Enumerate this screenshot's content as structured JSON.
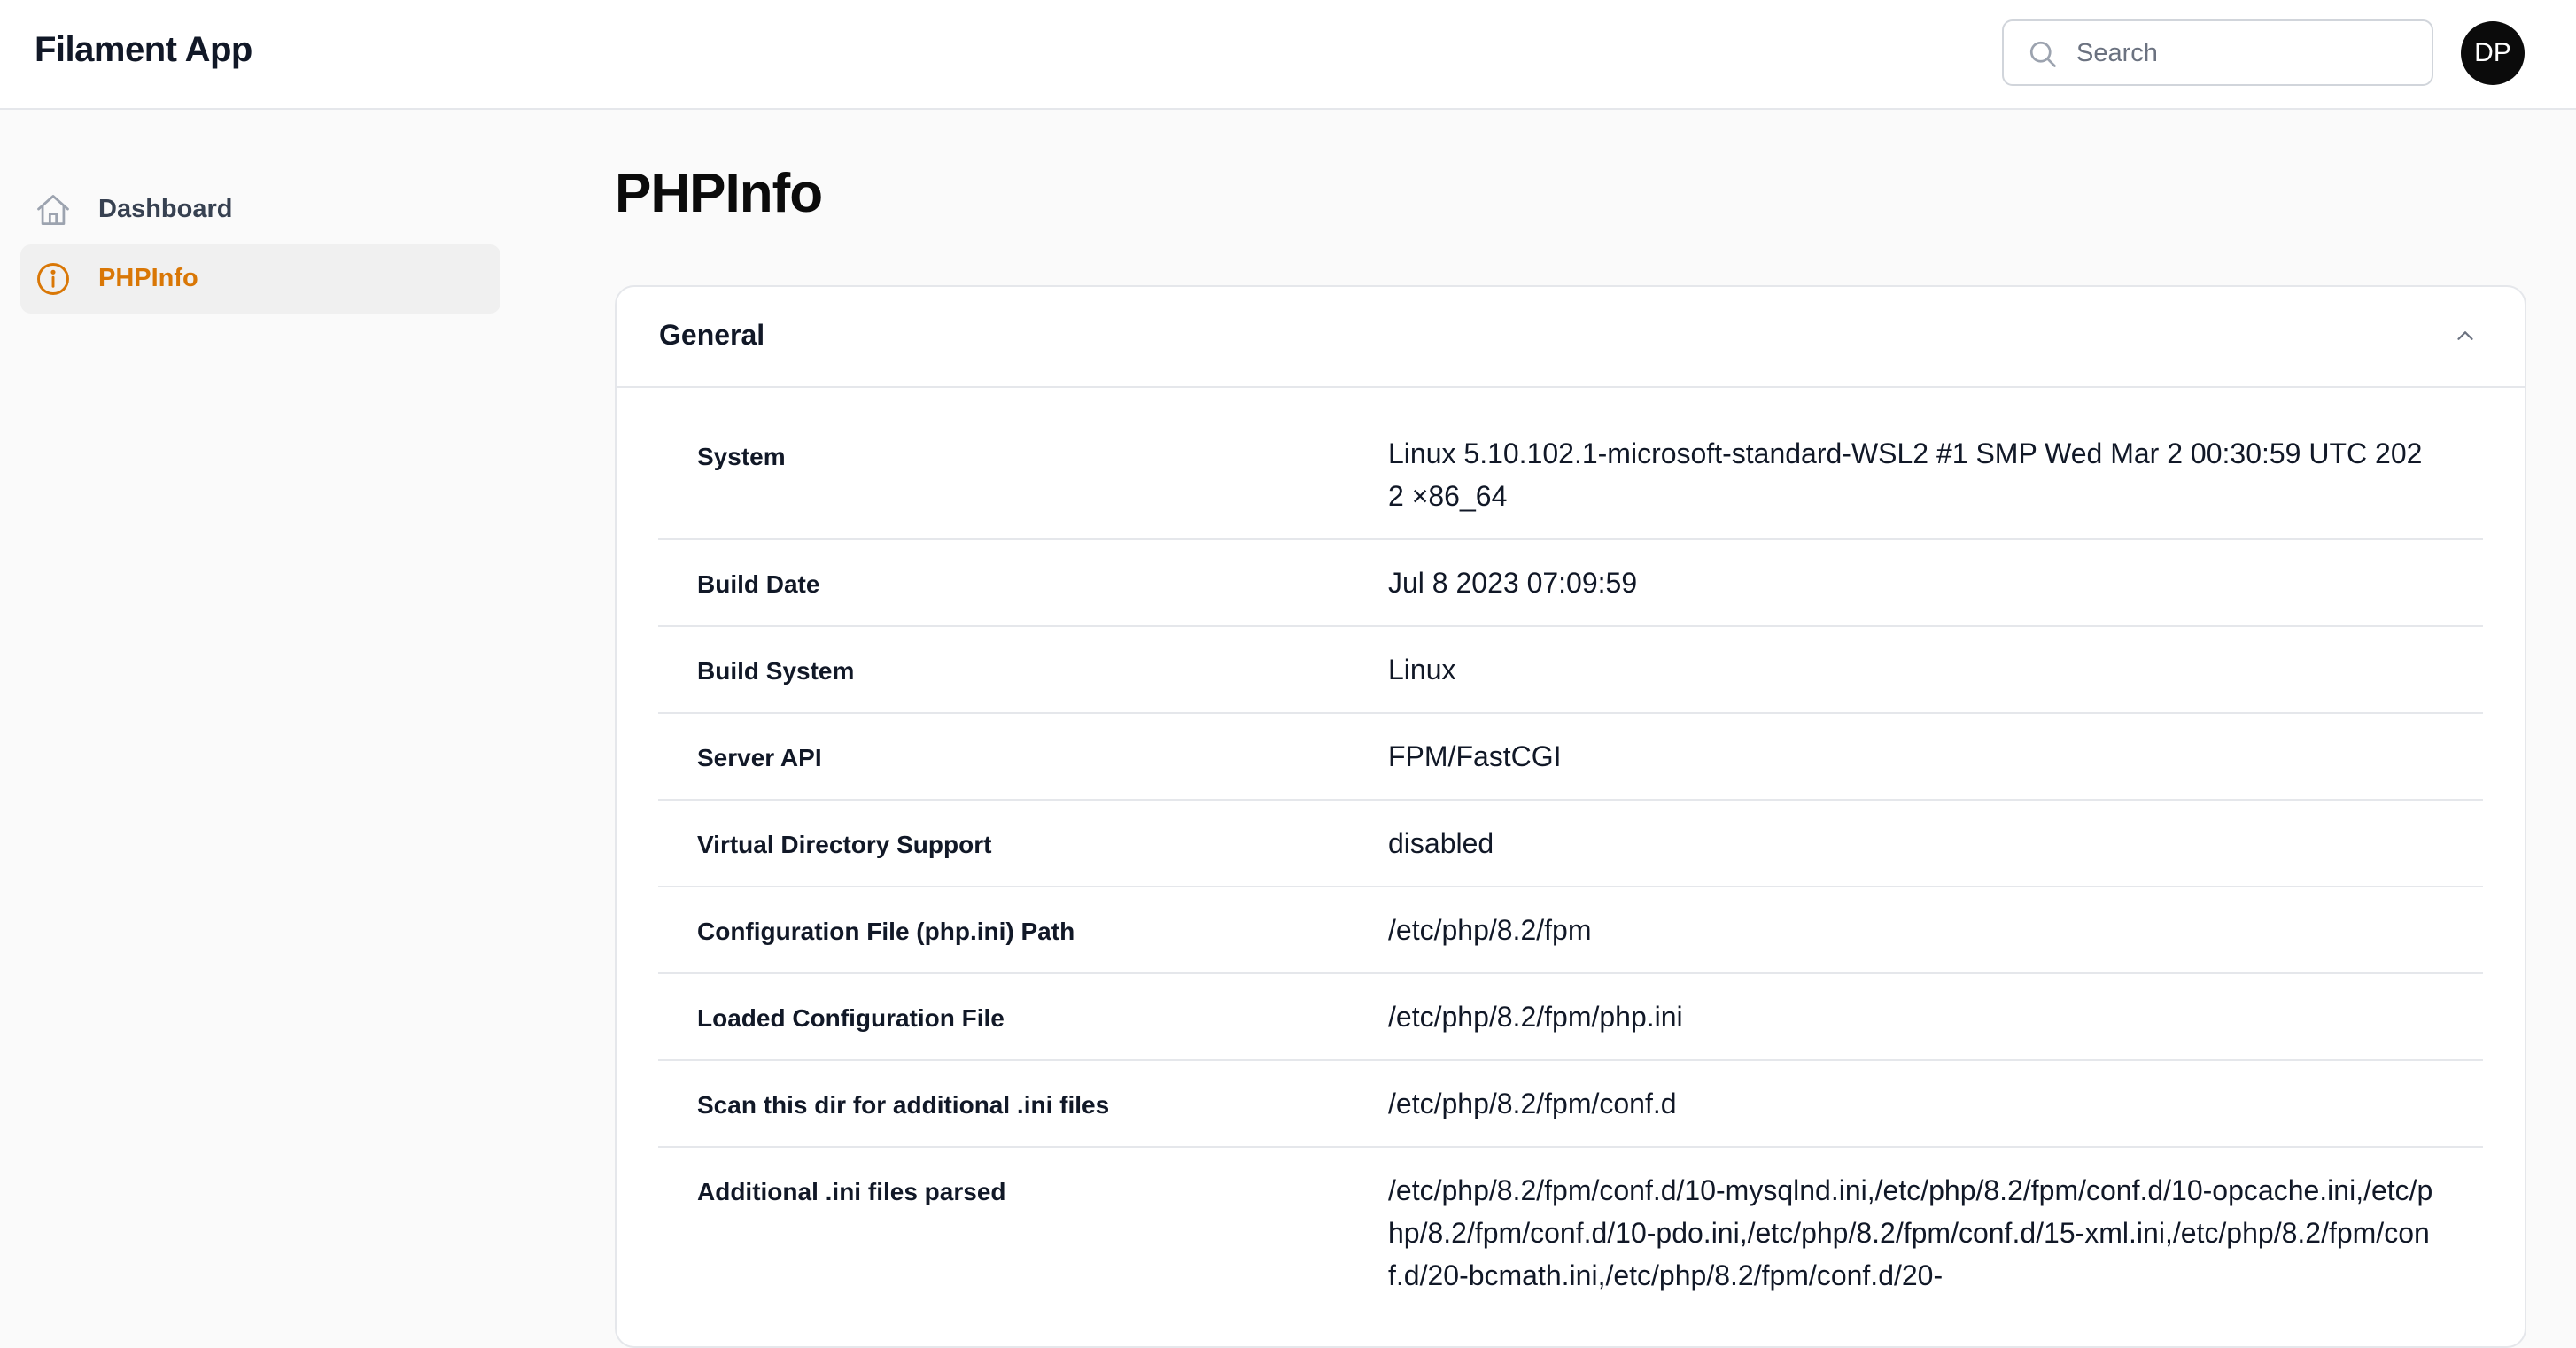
{
  "app": {
    "title": "Filament App"
  },
  "search": {
    "placeholder": "Search",
    "value": ""
  },
  "user": {
    "initials": "DP"
  },
  "sidebar": {
    "items": [
      {
        "label": "Dashboard",
        "icon": "home-icon",
        "active": false
      },
      {
        "label": "PHPInfo",
        "icon": "info-circle-icon",
        "active": true
      }
    ]
  },
  "page": {
    "title": "PHPInfo"
  },
  "section": {
    "title": "General",
    "expanded": true,
    "rows": [
      {
        "key": "System",
        "value": "Linux 5.10.102.1-microsoft-standard-WSL2 #1 SMP Wed Mar 2 00:30:59 UTC 2022 ×86_64"
      },
      {
        "key": "Build Date",
        "value": "Jul 8 2023 07:09:59"
      },
      {
        "key": "Build System",
        "value": "Linux"
      },
      {
        "key": "Server API",
        "value": "FPM/FastCGI"
      },
      {
        "key": "Virtual Directory Support",
        "value": "disabled"
      },
      {
        "key": "Configuration File (php.ini) Path",
        "value": "/etc/php/8.2/fpm"
      },
      {
        "key": "Loaded Configuration File",
        "value": "/etc/php/8.2/fpm/php.ini"
      },
      {
        "key": "Scan this dir for additional .ini files",
        "value": "/etc/php/8.2/fpm/conf.d"
      },
      {
        "key": "Additional .ini files parsed",
        "value": "/etc/php/8.2/fpm/conf.d/10-mysqlnd.ini,/etc/php/8.2/fpm/conf.d/10-opcache.ini,/etc/php/8.2/fpm/conf.d/10-pdo.ini,/etc/php/8.2/fpm/conf.d/15-xml.ini,/etc/php/8.2/fpm/conf.d/20-bcmath.ini,/etc/php/8.2/fpm/conf.d/20-"
      }
    ]
  },
  "colors": {
    "accent": "#d97706",
    "background": "#fafafa",
    "surface": "#ffffff",
    "border": "#e5e7eb",
    "text": "#111827"
  }
}
